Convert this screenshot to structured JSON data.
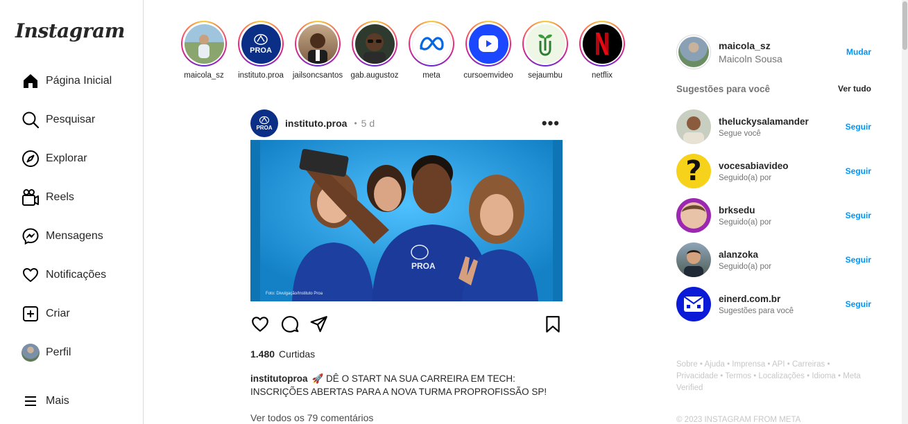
{
  "app": {
    "logo": "Instagram"
  },
  "sidebar": {
    "items": [
      {
        "label": "Página Inicial",
        "icon": "home-icon"
      },
      {
        "label": "Pesquisar",
        "icon": "search-icon"
      },
      {
        "label": "Explorar",
        "icon": "compass-icon"
      },
      {
        "label": "Reels",
        "icon": "reels-icon"
      },
      {
        "label": "Mensagens",
        "icon": "messenger-icon"
      },
      {
        "label": "Notificações",
        "icon": "heart-icon"
      },
      {
        "label": "Criar",
        "icon": "plus-square-icon"
      },
      {
        "label": "Perfil",
        "icon": "avatar"
      }
    ],
    "more": {
      "label": "Mais",
      "icon": "menu-icon"
    }
  },
  "stories": [
    {
      "name": "maicola_sz"
    },
    {
      "name": "instituto.proa"
    },
    {
      "name": "jailsoncsantos"
    },
    {
      "name": "gab.augustoz"
    },
    {
      "name": "meta"
    },
    {
      "name": "cursoemvideo"
    },
    {
      "name": "sejaumbu"
    },
    {
      "name": "netflix"
    }
  ],
  "post": {
    "username": "instituto.proa",
    "time": "5 d",
    "avatar_text": "PROA",
    "image_credit": "Foto: Divulgação/Instituto Proa",
    "shirt_text": "PROA",
    "likes_count": "1.480",
    "likes_label": "Curtidas",
    "caption_user": "institutoproa",
    "caption_text": "🚀 DÊ O START NA SUA CARREIRA EM TECH: INSCRIÇÕES ABERTAS PARA A NOVA TURMA PROPROFISSÃO SP!",
    "comments_link": "Ver todos os 79 comentários"
  },
  "profile": {
    "username": "maicola_sz",
    "name": "Maicoln Sousa",
    "switch_label": "Mudar"
  },
  "suggestions": {
    "title": "Sugestões para você",
    "see_all": "Ver tudo",
    "follow_label": "Seguir",
    "items": [
      {
        "username": "theluckysalamander",
        "subtitle": "Segue você"
      },
      {
        "username": "vocesabiavideo",
        "subtitle": "Seguido(a) por"
      },
      {
        "username": "brksedu",
        "subtitle": "Seguido(a) por"
      },
      {
        "username": "alanzoka",
        "subtitle": "Seguido(a) por"
      },
      {
        "username": "einerd.com.br",
        "subtitle": "Sugestões para você"
      }
    ]
  },
  "footer": {
    "line1": "Sobre • Ajuda • Imprensa • API • Carreiras •",
    "line2": "Privacidade • Termos • Localizações • Idioma • Meta",
    "line3": "Verified",
    "copyright": "© 2023 INSTAGRAM FROM META"
  },
  "colors": {
    "accent": "#0095f6",
    "proa_blue": "#0b2e86",
    "netflix_red": "#e50914",
    "meta_blue": "#0668e1"
  }
}
